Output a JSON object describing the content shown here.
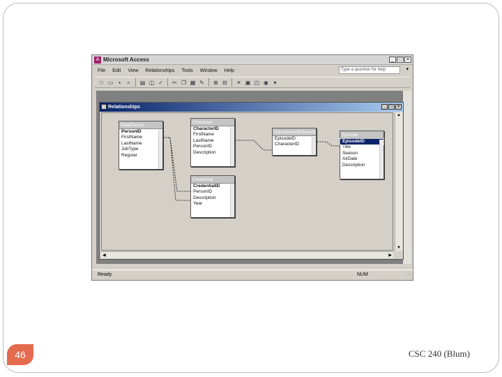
{
  "slide": {
    "number": "46",
    "footer": "CSC 240 (Blum)"
  },
  "window": {
    "title": "Microsoft Access",
    "buttons": [
      "_",
      "□",
      "×"
    ],
    "menu": [
      "File",
      "Edit",
      "View",
      "Relationships",
      "Tools",
      "Window",
      "Help"
    ],
    "help_placeholder": "Type a question for help",
    "status": "Ready",
    "status_num": "NUM"
  },
  "relationships": {
    "title": "Relationships",
    "buttons": [
      "_",
      "□",
      "×"
    ],
    "tables": [
      {
        "name": "RealPerson",
        "fields": [
          "PersonID",
          "FirstName",
          "LastName",
          "JobType",
          "Regular"
        ],
        "key": "PersonID"
      },
      {
        "name": "Character",
        "fields": [
          "CharacterID",
          "FirstName",
          "LastName",
          "PersonID",
          "Description"
        ],
        "key": "CharacterID"
      },
      {
        "name": "Credential",
        "fields": [
          "CredentialID",
          "PersonID",
          "Description",
          "Year"
        ],
        "key": "CredentialID"
      },
      {
        "name": "EpisodeAndCharacter",
        "fields": [
          "EpisodeID",
          "CharacterID"
        ],
        "key": ""
      },
      {
        "name": "Episode",
        "fields": [
          "EpisodeID",
          "Title",
          "Season",
          "AirDate",
          "Description"
        ],
        "key": "EpisodeID",
        "selected": "EpisodeID"
      }
    ]
  },
  "icons": {
    "toolbar": [
      "new-icon",
      "open-icon",
      "save-icon",
      "search-icon",
      "print-icon",
      "preview-icon",
      "spell-icon",
      "cut-icon",
      "copy-icon",
      "paste-icon",
      "format-icon",
      "show-table-icon",
      "show-all-icon",
      "delete-icon",
      "properties-icon",
      "new-object-icon",
      "help-icon"
    ]
  }
}
